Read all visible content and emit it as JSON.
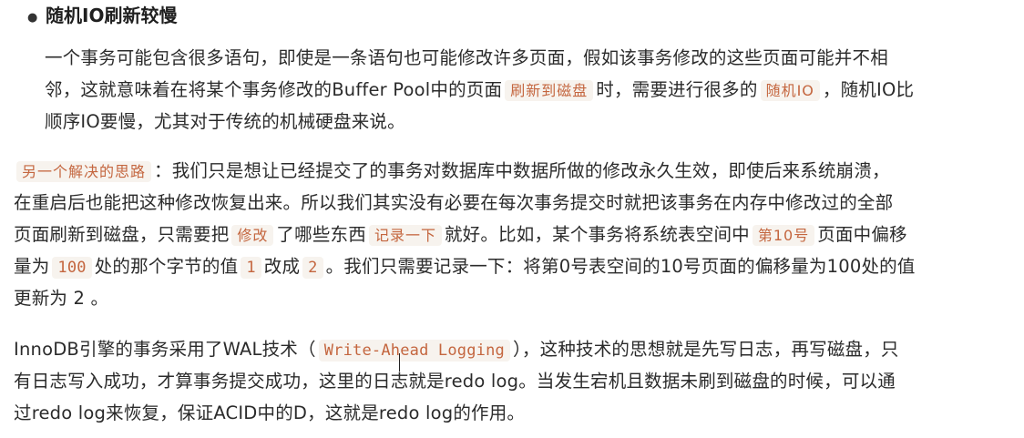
{
  "section": {
    "heading": "随机IO刷新较慢",
    "lines": [
      "一个事务可能包含很多语句，即使是一条语句也可能修改许多页面，假如该事务修改的这些页面可能并不相",
      {
        "a": "邻，这就意味着在将某个事务修改的Buffer Pool中的页面",
        "code1": "刷新到磁盘",
        "b": "时，需要进行很多的",
        "code2": "随机IO",
        "c": "，随机IO比"
      },
      "顺序IO要慢，尤其对于传统的机械硬盘来说。"
    ]
  },
  "solution": {
    "line1": {
      "code": "另一个解决的思路",
      "text": "：我们只是想让已经提交了的事务对数据库中数据所做的修改永久生效，即使后来系统崩溃，"
    },
    "line2": "在重启后也能把这种修改恢复出来。所以我们其实没有必要在每次事务提交时就把该事务在内存中修改过的全部",
    "line3": {
      "a": "页面刷新到磁盘，只需要把",
      "code1": "修改",
      "b": "了哪些东西",
      "code2": "记录一下",
      "c": "就好。比如，某个事务将系统表空间中",
      "code3": "第10号",
      "d": "页面中偏移"
    },
    "line4": {
      "a": "量为",
      "code1": "100",
      "b": "处的那个字节的值",
      "code2": "1",
      "c": "改成",
      "code3": "2",
      "d": "。我们只需要记录一下：将第0号表空间的10号页面的偏移量为100处的值"
    },
    "line5": "更新为 2 。"
  },
  "wal": {
    "line1": {
      "a": "InnoDB引擎的事务采用了WAL技术（",
      "code": "Write-Ahead Logging",
      "b": "），这种技术的思想就是先写日志，再写磁盘，只"
    },
    "line2": "有日志写入成功，才算事务提交成功，这里的日志就是redo log。当发生宕机且数据未刷到磁盘的时候，可以通",
    "line3": "过redo log来恢复，保证ACID中的D，这就是redo log的作用。"
  }
}
